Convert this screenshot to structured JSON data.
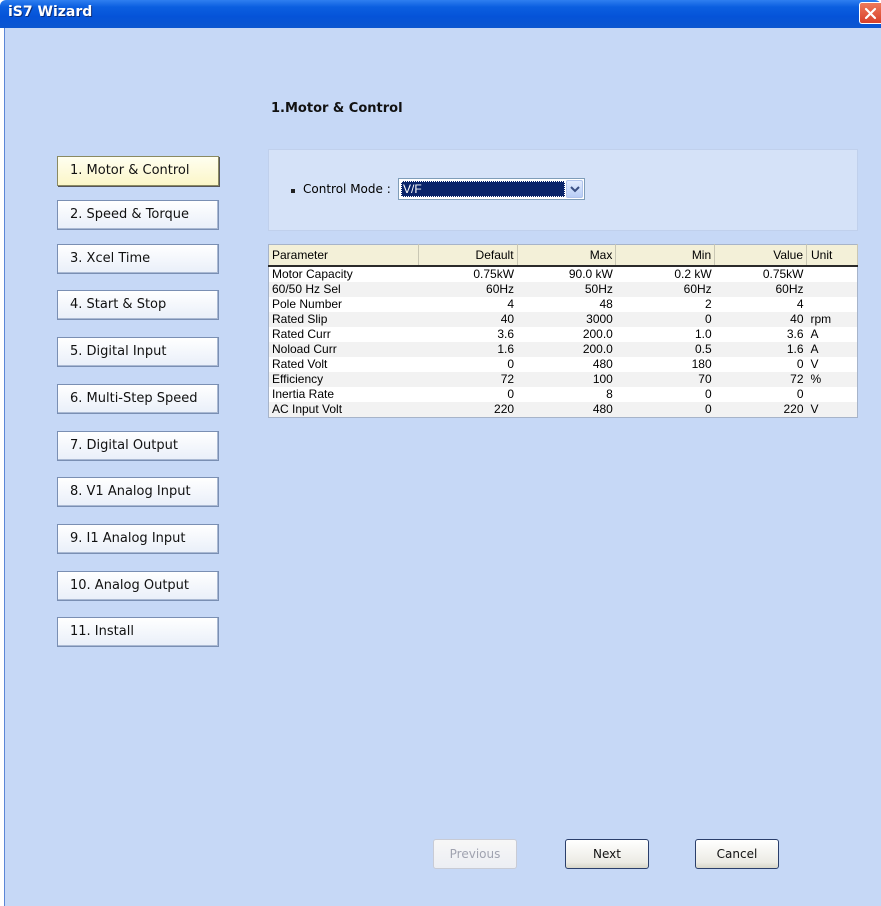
{
  "window": {
    "title": "iS7 Wizard"
  },
  "page": {
    "title": "1.Motor & Control"
  },
  "nav": {
    "items": [
      {
        "label": "1. Motor & Control",
        "active": true
      },
      {
        "label": "2. Speed & Torque"
      },
      {
        "label": "3. Xcel Time"
      },
      {
        "label": "4. Start & Stop"
      },
      {
        "label": "5. Digital Input"
      },
      {
        "label": "6. Multi-Step Speed"
      },
      {
        "label": "7. Digital Output"
      },
      {
        "label": "8. V1 Analog Input"
      },
      {
        "label": "9. I1 Analog Input"
      },
      {
        "label": "10. Analog Output"
      },
      {
        "label": "11. Install"
      }
    ]
  },
  "control_mode": {
    "label": "Control Mode :",
    "value": "V/F"
  },
  "table": {
    "headers": {
      "parameter": "Parameter",
      "default": "Default",
      "max": "Max",
      "min": "Min",
      "value": "Value",
      "unit": "Unit"
    },
    "rows": [
      {
        "parameter": "Motor Capacity",
        "default": "0.75kW",
        "max": "90.0 kW",
        "min": "0.2 kW",
        "value": "0.75kW",
        "unit": ""
      },
      {
        "parameter": "60/50 Hz Sel",
        "default": "60Hz",
        "max": "50Hz",
        "min": "60Hz",
        "value": "60Hz",
        "unit": ""
      },
      {
        "parameter": "Pole Number",
        "default": "4",
        "max": "48",
        "min": "2",
        "value": "4",
        "unit": ""
      },
      {
        "parameter": "Rated Slip",
        "default": "40",
        "max": "3000",
        "min": "0",
        "value": "40",
        "unit": "rpm"
      },
      {
        "parameter": "Rated Curr",
        "default": "3.6",
        "max": "200.0",
        "min": "1.0",
        "value": "3.6",
        "unit": "A"
      },
      {
        "parameter": "Noload Curr",
        "default": "1.6",
        "max": "200.0",
        "min": "0.5",
        "value": "1.6",
        "unit": "A"
      },
      {
        "parameter": "Rated Volt",
        "default": "0",
        "max": "480",
        "min": "180",
        "value": "0",
        "unit": "V"
      },
      {
        "parameter": "Efficiency",
        "default": "72",
        "max": "100",
        "min": "70",
        "value": "72",
        "unit": "%"
      },
      {
        "parameter": "Inertia Rate",
        "default": "0",
        "max": "8",
        "min": "0",
        "value": "0",
        "unit": ""
      },
      {
        "parameter": "AC Input Volt",
        "default": "220",
        "max": "480",
        "min": "0",
        "value": "220",
        "unit": "V"
      }
    ]
  },
  "buttons": {
    "previous": "Previous",
    "next": "Next",
    "cancel": "Cancel"
  },
  "icons": {
    "close": "close-icon",
    "dropdown": "chevron-down-icon",
    "bullet": "bullet-icon"
  }
}
